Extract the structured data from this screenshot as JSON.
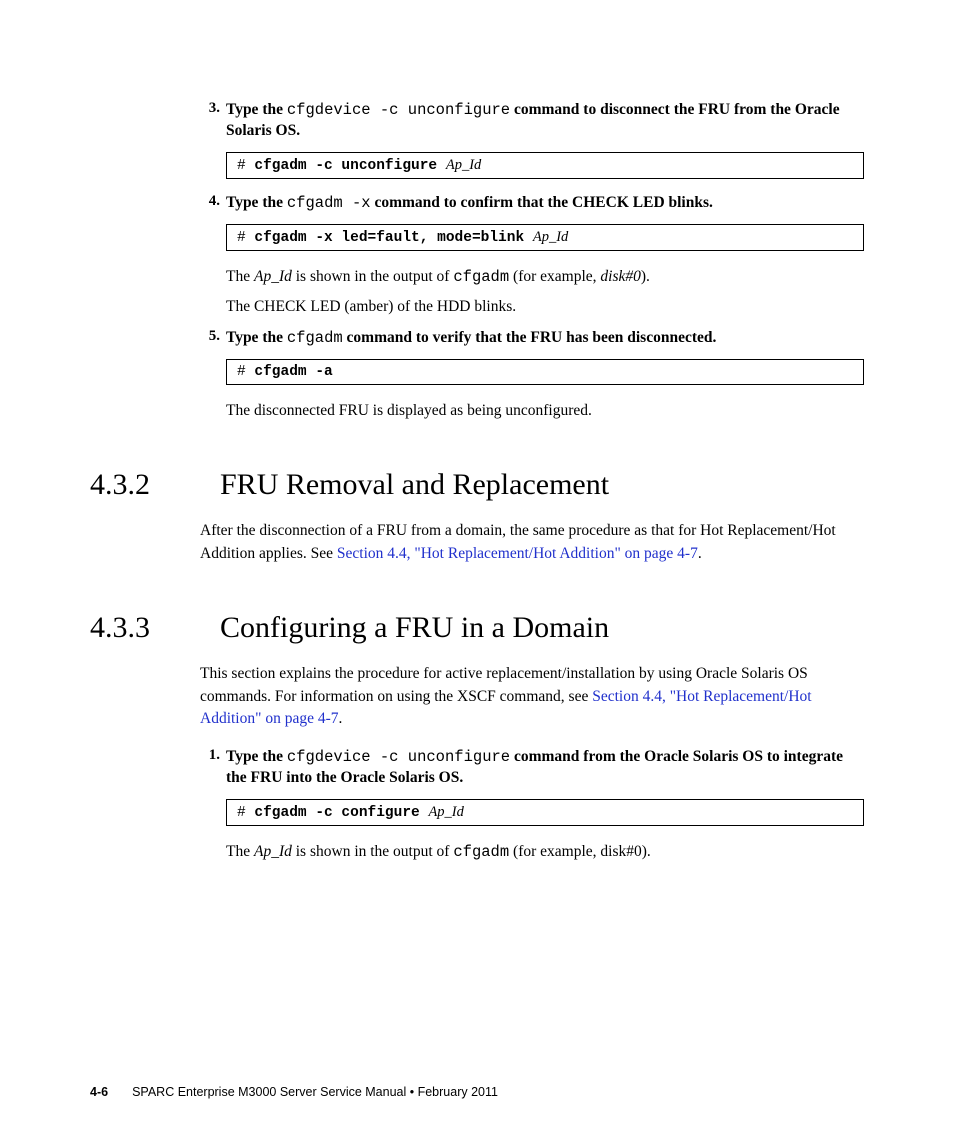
{
  "steps": {
    "s3": {
      "num": "3.",
      "pre": "Type the ",
      "cmd": "cfgdevice -c unconfigure",
      "post": " command to disconnect the FRU from the Oracle Solaris OS."
    },
    "code3": {
      "prompt": "# ",
      "bold": "cfgadm -c unconfigure ",
      "arg": "Ap_Id"
    },
    "s4": {
      "num": "4.",
      "pre": "Type the ",
      "cmd": "cfgadm -x",
      "post": " command to confirm that the CHECK LED blinks."
    },
    "code4": {
      "prompt": "# ",
      "bold": "cfgadm -x led=fault, mode=blink ",
      "arg": "Ap_Id"
    },
    "body4a_pre": "The ",
    "body4a_it": "Ap_Id",
    "body4a_mid": " is shown in the output of ",
    "body4a_mono": "cfgadm",
    "body4a_post1": " (for example, ",
    "body4a_it2": "disk#0",
    "body4a_post2": ").",
    "body4b": "The CHECK LED (amber) of the HDD blinks.",
    "s5": {
      "num": "5.",
      "pre": "Type the ",
      "cmd": "cfgadm",
      "post": " command to verify that the FRU has been disconnected."
    },
    "code5": {
      "prompt": "# ",
      "bold": "cfgadm -a"
    },
    "body5": "The disconnected FRU is displayed as being unconfigured."
  },
  "sec432": {
    "num": "4.3.2",
    "title": "FRU Removal and Replacement",
    "body_pre": "After the disconnection of a FRU from a domain, the same procedure as that for Hot Replacement/Hot Addition applies. See ",
    "link": "Section 4.4, \"Hot Replacement/Hot Addition\" on page 4-7",
    "body_post": "."
  },
  "sec433": {
    "num": "4.3.3",
    "title": "Configuring a FRU in a Domain",
    "body_pre": "This section explains the procedure for active replacement/installation by using Oracle Solaris OS commands. For information on using the XSCF command, see ",
    "link": "Section 4.4, \"Hot Replacement/Hot Addition\" on page 4-7",
    "body_post": ".",
    "s1": {
      "num": "1.",
      "pre": "Type the ",
      "cmd": "cfgdevice -c unconfigure",
      "post": " command from the Oracle Solaris OS to integrate the FRU into the Oracle Solaris OS."
    },
    "code1": {
      "prompt": "# ",
      "bold": "cfgadm -c configure ",
      "arg": "Ap_Id"
    },
    "body1_pre": "The ",
    "body1_it": "Ap_Id",
    "body1_mid": " is shown in the output of ",
    "body1_mono": "cfgadm",
    "body1_post": " (for example, disk#0)."
  },
  "footer": {
    "page": "4-6",
    "title": "SPARC Enterprise M3000 Server Service Manual  •  February 2011"
  }
}
